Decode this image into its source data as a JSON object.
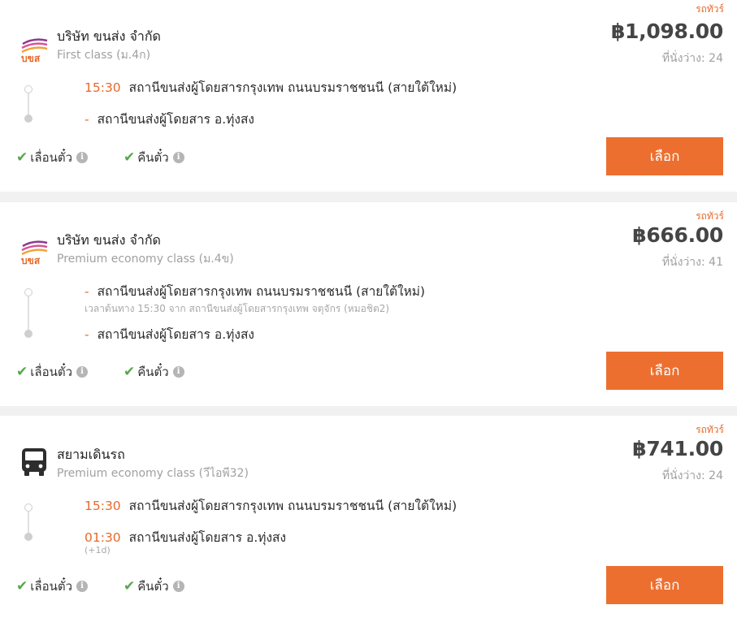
{
  "trips": [
    {
      "bus_type": "รถทัวร์",
      "company": "บริษัท ขนส่ง จำกัด",
      "class": "First class (ม.4ก)",
      "price": "฿1,098.00",
      "seats": "ที่นั่งว่าง: 24",
      "depart_time": "15:30",
      "depart_station": "สถานีขนส่งผู้โดยสารกรุงเทพ ถนนบรมราชชนนี (สายใต้ใหม่)",
      "arrive_marker": "-",
      "arrive_station": "สถานีขนส่งผู้โดยสาร อ.ทุ่งสง",
      "feature_1": "เลื่อนตั๋ว",
      "feature_2": "คืนตั๋ว",
      "select_label": "เลือก",
      "logo": "bks-logo"
    },
    {
      "bus_type": "รถทัวร์",
      "company": "บริษัท ขนส่ง จำกัด",
      "class": "Premium economy class (ม.4ข)",
      "price": "฿666.00",
      "seats": "ที่นั่งว่าง: 41",
      "depart_marker": "-",
      "depart_station": "สถานีขนส่งผู้โดยสารกรุงเทพ ถนนบรมราชชนนี (สายใต้ใหม่)",
      "depart_note": "เวลาต้นทาง 15:30   จาก สถานีขนส่งผู้โดยสารกรุงเทพ จตุจักร (หมอชิต2)",
      "arrive_marker": "-",
      "arrive_station": "สถานีขนส่งผู้โดยสาร อ.ทุ่งสง",
      "feature_1": "เลื่อนตั๋ว",
      "feature_2": "คืนตั๋ว",
      "select_label": "เลือก",
      "logo": "bks-logo"
    },
    {
      "bus_type": "รถทัวร์",
      "company": "สยามเดินรถ",
      "class": "Premium economy class (วีไอพี32)",
      "price": "฿741.00",
      "seats": "ที่นั่งว่าง: 24",
      "depart_time": "15:30",
      "depart_station": "สถานีขนส่งผู้โดยสารกรุงเทพ ถนนบรมราชชนนี (สายใต้ใหม่)",
      "arrive_time": "01:30",
      "arrive_station": "สถานีขนส่งผู้โดยสาร อ.ทุ่งสง",
      "arrive_note": "(+1d)",
      "feature_1": "เลื่อนตั๋ว",
      "feature_2": "คืนตั๋ว",
      "select_label": "เลือก",
      "logo": "bus-icon"
    }
  ],
  "colors": {
    "accent": "#ED6F2F",
    "check": "#55A84B",
    "price": "#454545",
    "muted": "#A0A0A0"
  }
}
